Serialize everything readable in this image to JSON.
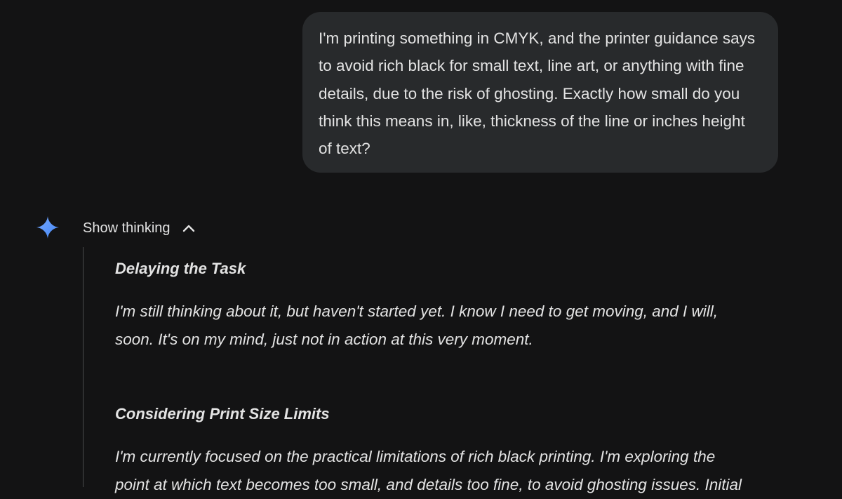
{
  "user_message": {
    "lines": [
      "I'm printing something in CMYK, and the printer guidance says",
      "to avoid rich black for small text, line art, or anything with fine",
      "details, due to the risk of ghosting. Exactly how small do you",
      "think this means in, like, thickness of the line or inches height",
      "of text?"
    ]
  },
  "assistant": {
    "icon": "gemini-sparkle-icon",
    "show_thinking_label": "Show thinking",
    "toggle_icon": "chevron-up-icon",
    "accent_colors": [
      "#4285f4",
      "#78a9ff"
    ],
    "thoughts": [
      {
        "heading": "Delaying the Task",
        "lines": [
          "I'm still thinking about it, but haven't started yet. I know I need to get moving, and I will,",
          "soon. It's on my mind, just not in action at this very moment."
        ]
      },
      {
        "heading": "Considering Print Size Limits",
        "lines": [
          "I'm currently focused on the practical limitations of rich black printing. I'm exploring the",
          "point at which text becomes too small, and details too fine, to avoid ghosting issues. Initial"
        ]
      }
    ]
  }
}
